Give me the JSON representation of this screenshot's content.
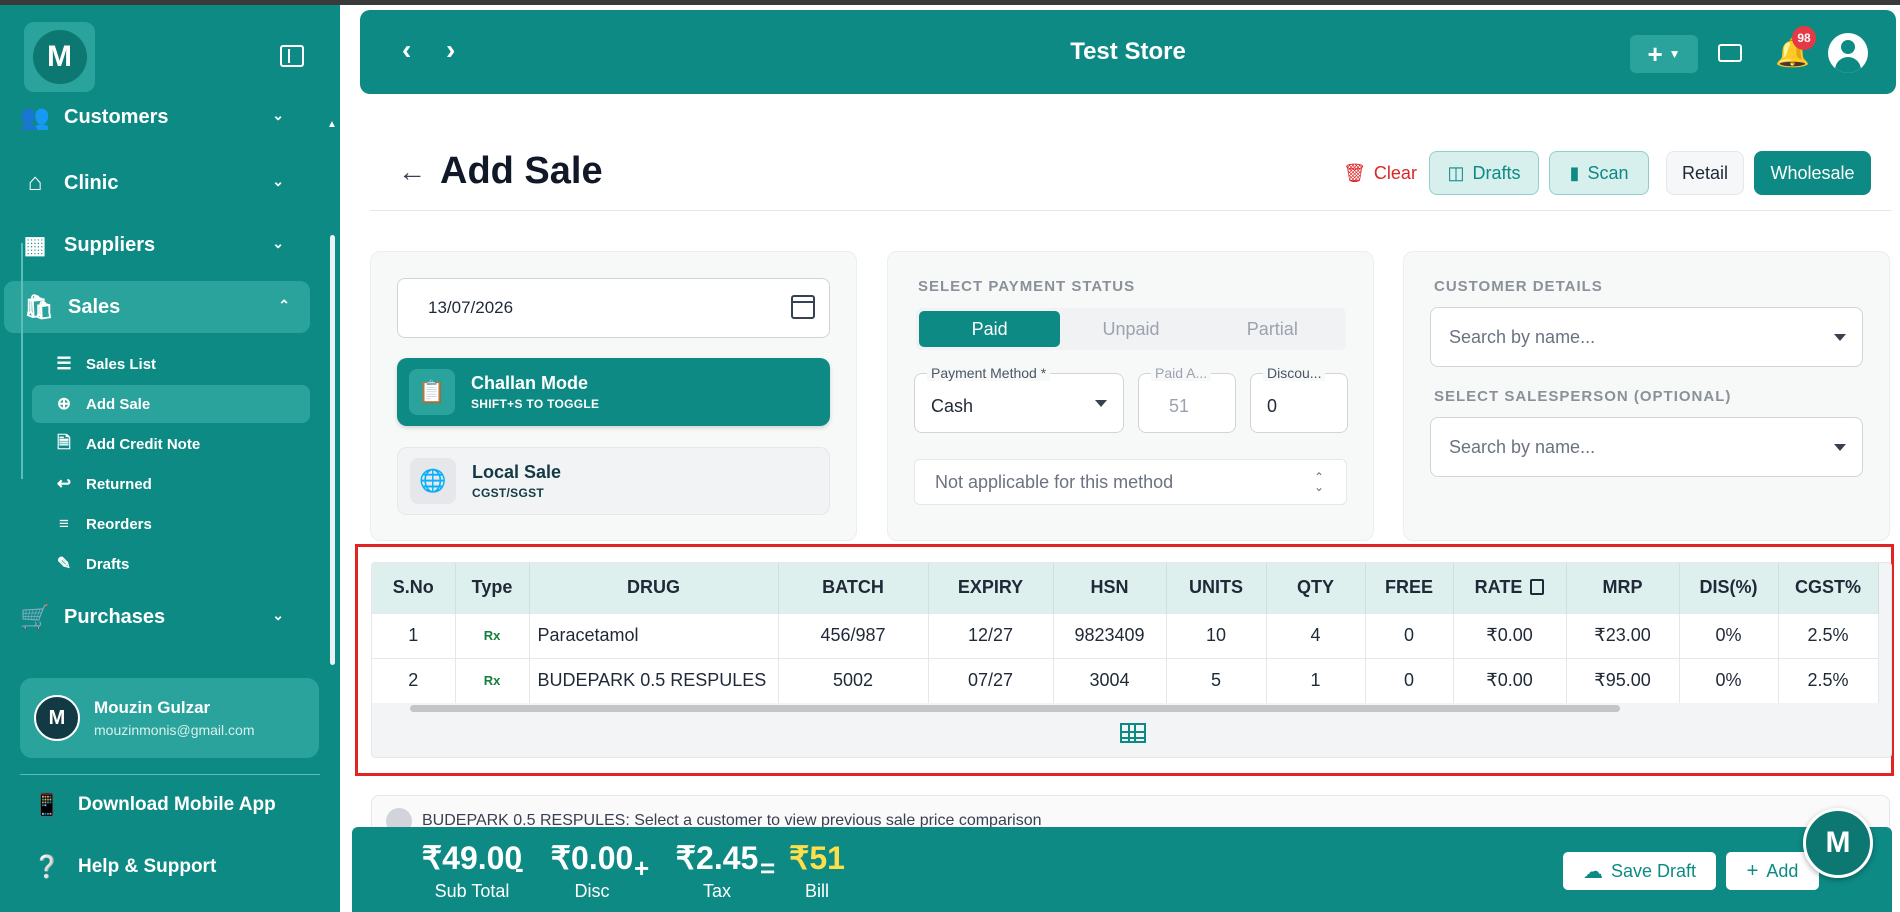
{
  "app": {
    "logo_letter": "M",
    "store_name": "Test Store",
    "notification_count": "98"
  },
  "sidebar": {
    "items": [
      {
        "label": "Customers",
        "icon": "users-icon"
      },
      {
        "label": "Clinic",
        "icon": "clinic-icon"
      },
      {
        "label": "Suppliers",
        "icon": "building-icon"
      },
      {
        "label": "Sales",
        "icon": "bag-icon"
      },
      {
        "label": "Purchases",
        "icon": "cart-icon"
      }
    ],
    "sales_sub": [
      {
        "label": "Sales List",
        "icon": "list-icon"
      },
      {
        "label": "Add Sale",
        "icon": "plus-circle-icon"
      },
      {
        "label": "Add Credit Note",
        "icon": "file-icon"
      },
      {
        "label": "Returned",
        "icon": "return-icon"
      },
      {
        "label": "Reorders",
        "icon": "menu-icon"
      },
      {
        "label": "Drafts",
        "icon": "edit-icon"
      }
    ],
    "user": {
      "initial": "M",
      "name": "Mouzin Gulzar",
      "email": "mouzinmonis@gmail.com"
    },
    "download_label": "Download Mobile App",
    "help_label": "Help & Support"
  },
  "page": {
    "title": "Add Sale",
    "buttons": {
      "clear": "Clear",
      "drafts": "Drafts",
      "scan": "Scan",
      "retail": "Retail",
      "wholesale": "Wholesale"
    }
  },
  "card1": {
    "date": "13/07/2026",
    "challan_title": "Challan Mode",
    "challan_sub": "SHIFT+S TO TOGGLE",
    "local_title": "Local Sale",
    "local_sub": "CGST/SGST"
  },
  "payment": {
    "section_label": "SELECT PAYMENT STATUS",
    "statuses": [
      "Paid",
      "Unpaid",
      "Partial"
    ],
    "selected": "Paid",
    "method_label": "Payment Method *",
    "method_value": "Cash",
    "paid_label": "Paid A...",
    "paid_value": "51",
    "discount_label": "Discou...",
    "discount_value": "0",
    "na_text": "Not applicable for this method"
  },
  "customer": {
    "section_label": "CUSTOMER DETAILS",
    "placeholder": "Search by name...",
    "salesperson_label": "SELECT SALESPERSON (OPTIONAL)",
    "salesperson_placeholder": "Search by name..."
  },
  "table": {
    "headers": [
      "S.No",
      "Type",
      "DRUG",
      "BATCH",
      "EXPIRY",
      "HSN",
      "UNITS",
      "QTY",
      "FREE",
      "RATE",
      "MRP",
      "DIS(%)",
      "CGST%"
    ],
    "rows": [
      [
        "1",
        "Rx",
        "Paracetamol",
        "456/987",
        "12/27",
        "9823409",
        "10",
        "4",
        "0",
        "₹0.00",
        "₹23.00",
        "0%",
        "2.5%"
      ],
      [
        "2",
        "Rx",
        "BUDEPARK 0.5 RESPULES",
        "5002",
        "07/27",
        "3004",
        "5",
        "1",
        "0",
        "₹0.00",
        "₹95.00",
        "0%",
        "2.5%"
      ]
    ]
  },
  "info": {
    "text": "BUDEPARK 0.5 RESPULES: Select a customer to view previous sale price comparison"
  },
  "footer": {
    "subtotal": "₹49.00",
    "subtotal_label": "Sub Total",
    "disc": "₹0.00",
    "disc_label": "Disc",
    "tax": "₹2.45",
    "tax_label": "Tax",
    "bill": "₹51",
    "bill_label": "Bill",
    "op_minus": "-",
    "op_plus": "+",
    "op_eq": "=",
    "save_draft": "Save Draft",
    "add": "Add"
  },
  "colors": {
    "brand": "#0d8a84",
    "brand_light": "#2aa39c",
    "danger": "#dc2626",
    "highlight": "#e02424",
    "bill": "#fde047"
  }
}
